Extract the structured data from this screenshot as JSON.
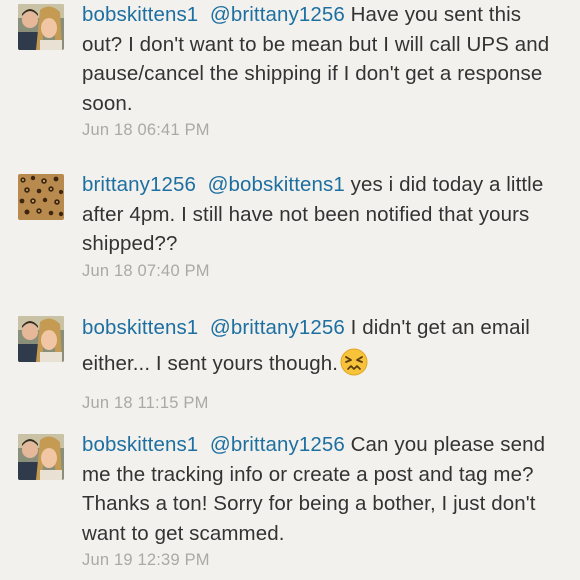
{
  "comments": [
    {
      "username": "bobskittens1",
      "mention": "@brittany1256",
      "text": "Have you sent this out? I don't want to be mean but I will call UPS and pause/cancel the shipping if I don't get a response soon.",
      "time": "Jun 18 06:41 PM",
      "avatar": "couple-photo"
    },
    {
      "username": "brittany1256",
      "mention": "@bobskittens1",
      "text": " yes i did today a little after 4pm. I still have not been notified that yours shipped??",
      "time": "Jun 18 07:40 PM",
      "avatar": "leopard-print"
    },
    {
      "username": "bobskittens1",
      "mention": "@brittany1256",
      "text": "I didn't get an email either... I sent yours though.",
      "time": "Jun 18 11:15 PM",
      "avatar": "couple-photo",
      "emoji": "confounded-face"
    },
    {
      "username": "bobskittens1",
      "mention": "@brittany1256",
      "text": "Can you please send me the tracking info or create a post and tag me? Thanks a ton! Sorry for being a bother, I just don't want to get scammed.",
      "time": "Jun 19 12:39 PM",
      "avatar": "couple-photo"
    }
  ],
  "colors": {
    "background": "#f2f1ee",
    "link": "#1d6fa0",
    "text": "#333333",
    "timestamp": "#a9a9a6"
  }
}
